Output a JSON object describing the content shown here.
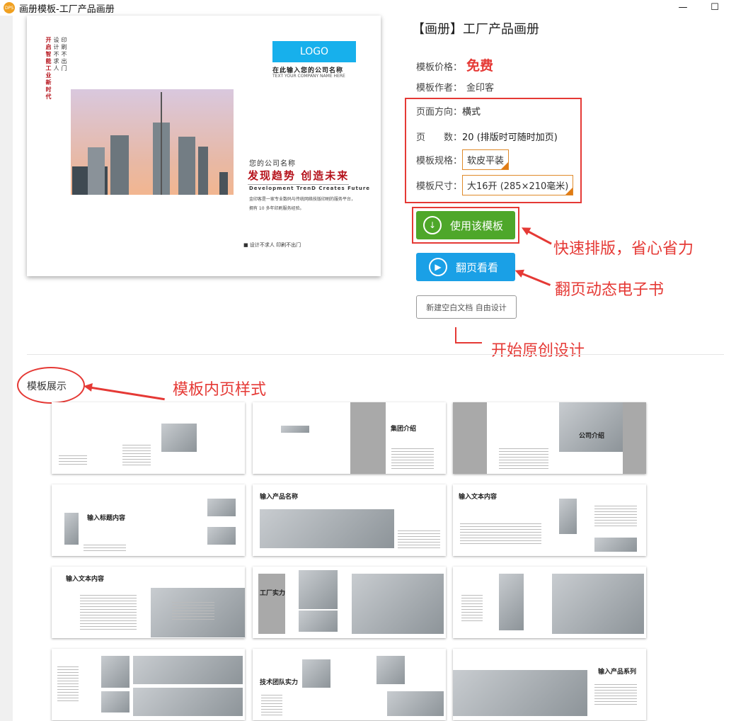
{
  "window": {
    "title": "画册模板-工厂产品画册",
    "app_icon": "DPS",
    "minimize": "—",
    "maximize": "☐"
  },
  "cover": {
    "vertical_red": "开启智能工业新时代",
    "vertical_1": "设计不求人",
    "vertical_2": "印刷不出门",
    "logo": "LOGO",
    "company_placeholder": "在此输入您的公司名称",
    "company_placeholder_en": "TEXT YOUR COMPANY NAME HERE",
    "your_company": "您的公司名称",
    "slogan": "发现趋势  创造未来",
    "slogan_en": "Development TrenD Creates Future",
    "description": "金印客是一家专业数码与传统网络技版印刷的服务平台，拥有 10 多年印刷服务经验。",
    "tagline": "■ 设计不求人    印刷不出门"
  },
  "info": {
    "title": "【画册】工厂产品画册",
    "price_label": "模板价格：",
    "price": "免费",
    "author_label": "模板作者：",
    "author": "金印客",
    "orientation_label": "页面方向：",
    "orientation": "横式",
    "pages_label": "页　　数：",
    "pages": "20 (排版时可随时加页)",
    "spec_label": "模板规格：",
    "spec": "软皮平装",
    "size_label": "模板尺寸：",
    "size": "大16开 (285×210毫米)"
  },
  "buttons": {
    "use": "使用该模板",
    "flip": "翻页看看",
    "blank": "新建空白文档 自由设计"
  },
  "annotations": {
    "fast": "快速排版，省心省力",
    "flipbook": "翻页动态电子书",
    "original": "开始原创设计",
    "inner_pages": "模板内页样式"
  },
  "showcase": {
    "label": "模板展示",
    "thumb_titles": [
      "",
      "集团介绍",
      "公司介绍",
      "输入标题内容",
      "输入产品名称",
      "输入文本内容",
      "输入文本内容",
      "工厂实力",
      "",
      "",
      "技术团队实力",
      "输入产品系列"
    ]
  },
  "colors": {
    "accent_red": "#e53935",
    "green": "#4ea72a",
    "blue": "#1aa0e6",
    "logo_blue": "#17b0ec"
  }
}
